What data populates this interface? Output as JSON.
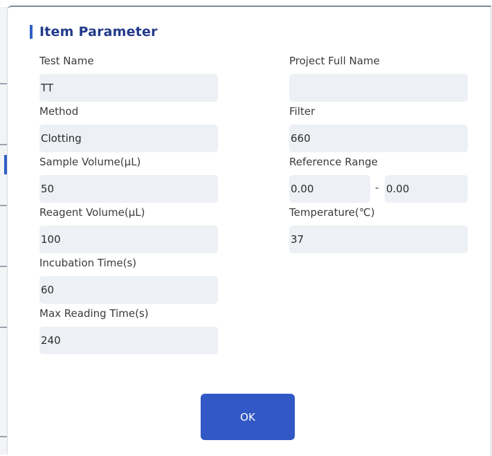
{
  "dialog": {
    "title": "Item Parameter",
    "ok_label": "OK"
  },
  "fields": {
    "test_name": {
      "label": "Test Name",
      "value": "TT"
    },
    "project_full_name": {
      "label": "Project Full Name",
      "value": ""
    },
    "method": {
      "label": "Method",
      "value": "Clotting"
    },
    "filter": {
      "label": "Filter",
      "value": "660"
    },
    "sample_volume": {
      "label": "Sample Volume(μL)",
      "value": "50"
    },
    "reference_range": {
      "label": "Reference Range",
      "min": "0.00",
      "max": "0.00",
      "separator": "-"
    },
    "reagent_volume": {
      "label": "Reagent Volume(μL)",
      "value": "100"
    },
    "temperature": {
      "label": "Temperature(℃)",
      "value": "37"
    },
    "incubation_time": {
      "label": "Incubation Time(s)",
      "value": "60"
    },
    "max_reading_time": {
      "label": "Max Reading Time(s)",
      "value": "240"
    }
  },
  "colors": {
    "accent": "#2f5fc7",
    "title": "#233a8a",
    "field_bg": "#edf0f4",
    "button_bg": "#3158c4"
  }
}
